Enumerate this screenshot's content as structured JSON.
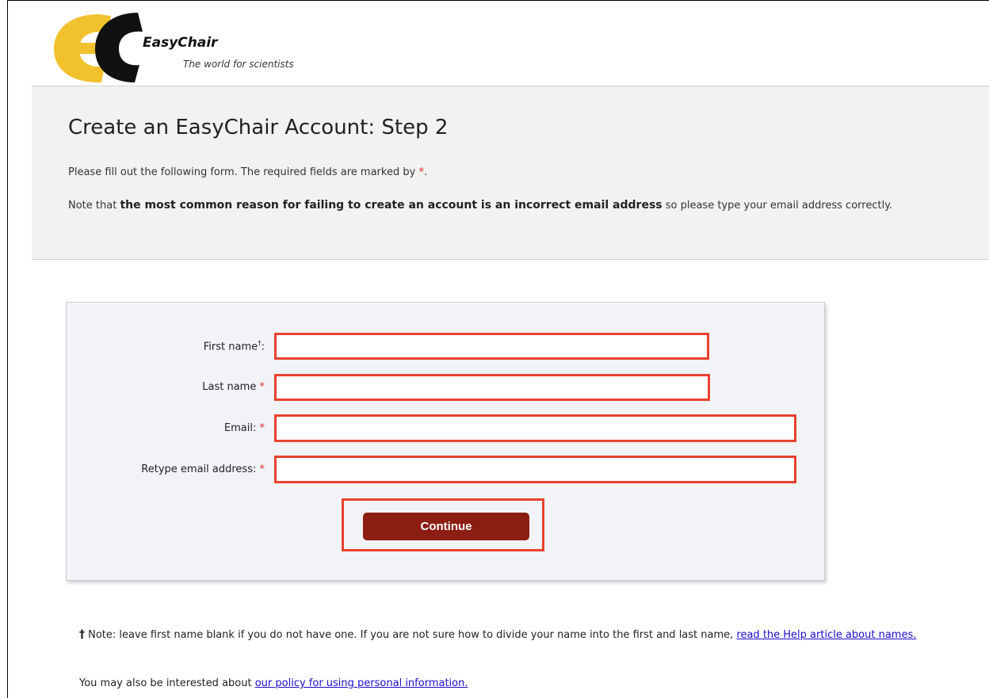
{
  "brand": {
    "name": "EasyChair",
    "tagline": "The world for scientists",
    "colors": {
      "yellow": "#f2c12e",
      "black": "#111111"
    }
  },
  "intro": {
    "title": "Create an EasyChair Account: Step 2",
    "line1_text": "Please fill out the following form. The required fields are marked by ",
    "required_marker": "*",
    "line1_end": ".",
    "line2_prefix": "Note that ",
    "line2_bold": "the most common reason for failing to create an account is an incorrect email address",
    "line2_suffix": " so please type your email address correctly."
  },
  "form": {
    "fields": [
      {
        "label": "First name",
        "suffix_marker": "†",
        "suffix_colon": ":",
        "value": ""
      },
      {
        "label": "Last name",
        "required_marker": "*",
        "value": ""
      },
      {
        "label": "Email:",
        "required_marker": "*",
        "value": ""
      },
      {
        "label": "Retype email address:",
        "required_marker": "*",
        "value": ""
      }
    ],
    "submit_label": "Continue"
  },
  "notes": {
    "dagger": "†",
    "note1_text": " Note: leave first name blank if you do not have one. If you are not sure how to divide your name into the first and last name, ",
    "note1_link": "read the Help article about names.",
    "note2_text": "You may also be interested about ",
    "note2_link": "our policy for using personal information."
  },
  "colors": {
    "highlight_border": "#e8412f",
    "button_bg": "#8b1d12",
    "required_star": "#e02828",
    "link": "#1a0dcc"
  }
}
